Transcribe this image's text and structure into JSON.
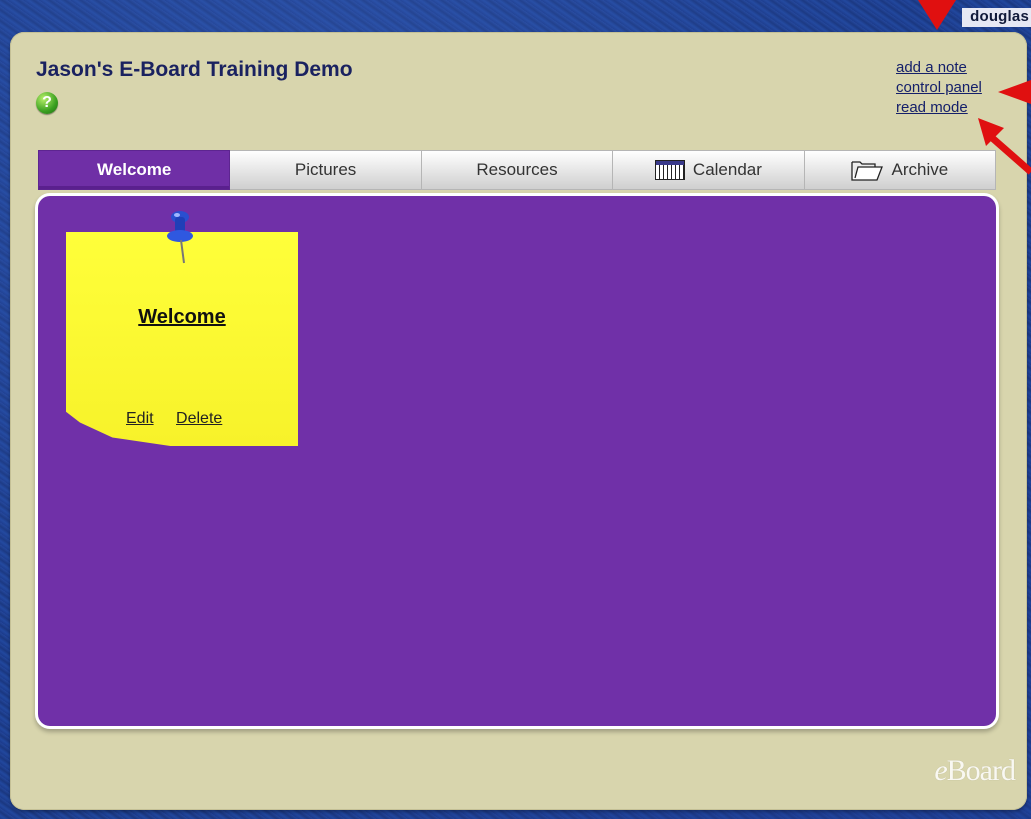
{
  "header": {
    "username": "douglas"
  },
  "board": {
    "title": "Jason's E-Board Training Demo",
    "help_icon": "question-mark-icon",
    "links": {
      "add_note": "add a note",
      "control_panel": "control panel",
      "read_mode": "read mode"
    }
  },
  "tabs": [
    {
      "label": "Welcome",
      "active": true
    },
    {
      "label": "Pictures"
    },
    {
      "label": "Resources"
    },
    {
      "label": "Calendar",
      "icon": "calendar-icon"
    },
    {
      "label": "Archive",
      "icon": "folder-icon"
    }
  ],
  "note": {
    "title": "Welcome",
    "edit_label": "Edit",
    "delete_label": "Delete",
    "icon": "pushpin-icon"
  },
  "footer": {
    "logo_prefix": "e",
    "logo_rest": "Board"
  },
  "colors": {
    "content_bg": "#7030a8",
    "panel_bg": "#d8d5ad",
    "note_bg": "#ffff3a",
    "title_text": "#1a2260",
    "arrow": "#e01010"
  }
}
